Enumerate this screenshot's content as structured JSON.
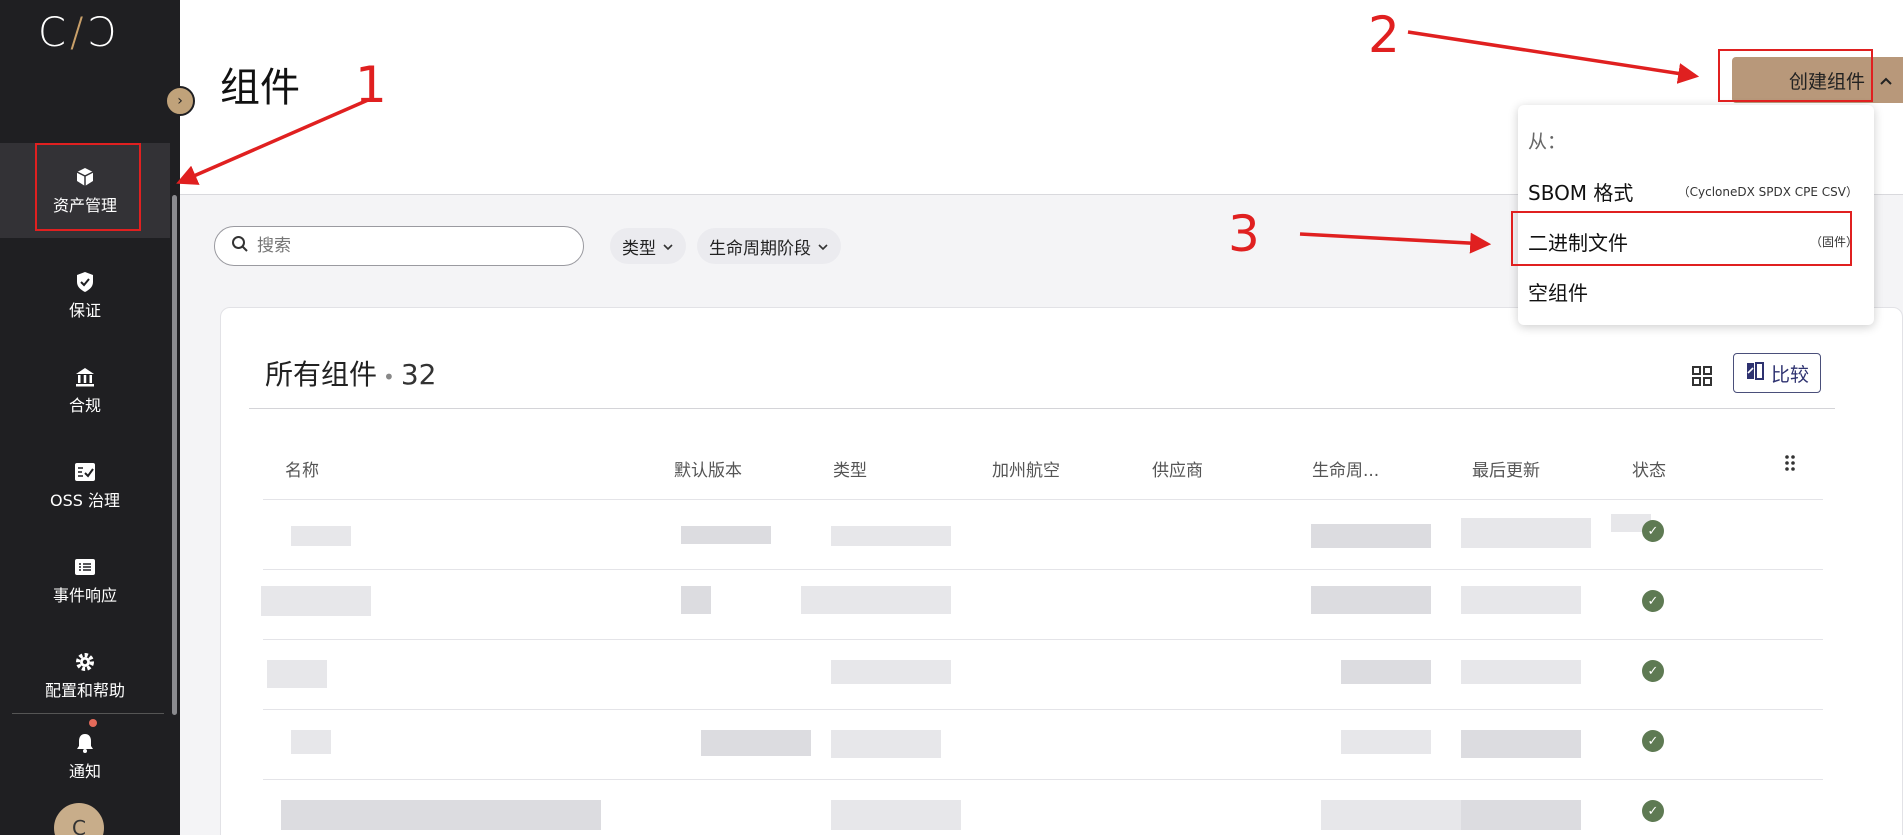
{
  "sidebar": {
    "logo": "C/C",
    "items": [
      {
        "label": "资产管理",
        "icon": "cube-icon"
      },
      {
        "label": "保证",
        "icon": "shield-icon"
      },
      {
        "label": "合规",
        "icon": "bank-icon"
      },
      {
        "label": "OSS 治理",
        "icon": "checklist-icon"
      },
      {
        "label": "事件响应",
        "icon": "list-icon"
      },
      {
        "label": "配置和帮助",
        "icon": "gear-icon"
      },
      {
        "label": "通知",
        "icon": "bell-icon"
      }
    ],
    "avatar_initial": "C"
  },
  "header": {
    "title": "组件",
    "create_button": "创建组件"
  },
  "filters": {
    "search_placeholder": "搜索",
    "type_label": "类型",
    "lifecycle_label": "生命周期阶段"
  },
  "card": {
    "title": "所有组件",
    "count": "32",
    "compare_label": "比较",
    "columns": [
      "名称",
      "默认版本",
      "类型",
      "加州航空",
      "供应商",
      "生命周...",
      "最后更新",
      "状态"
    ]
  },
  "dropdown": {
    "heading": "从：",
    "items": [
      {
        "label": "SBOM 格式",
        "sub": "（CycloneDX SPDX CPE CSV）"
      },
      {
        "label": "二进制文件",
        "sub": "（固件）"
      },
      {
        "label": "空组件",
        "sub": ""
      }
    ]
  },
  "annotations": {
    "one": "1",
    "two": "2",
    "three": "3",
    "color": "#e02020"
  }
}
